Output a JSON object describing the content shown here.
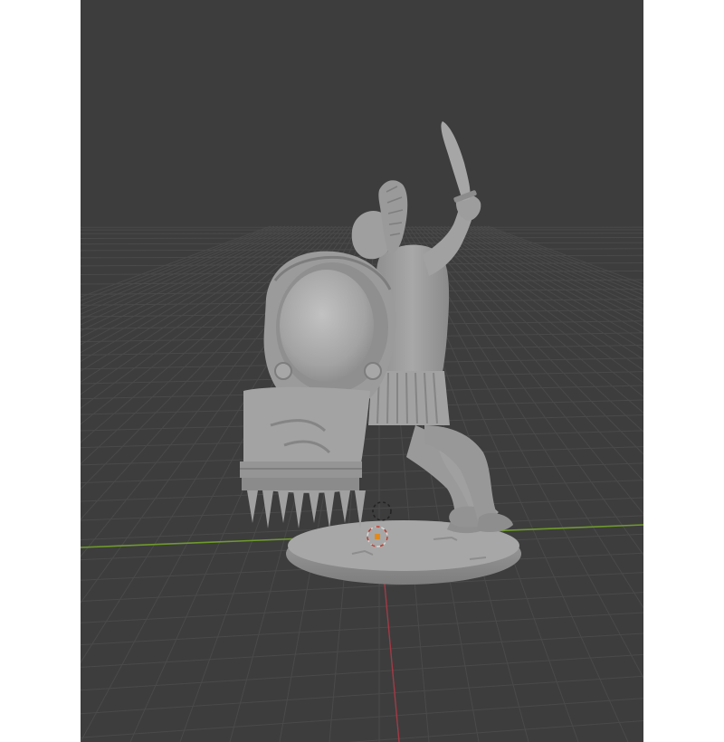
{
  "app": {
    "name": "3D viewport",
    "view": "perspective"
  },
  "viewport": {
    "background_color": "#3d3d3d",
    "grid_line_color": "#4a4a4a",
    "x_axis_color": "#6f9a2c",
    "y_axis_color": "#a33a45",
    "model_color": "#9c9c9c"
  },
  "scene": {
    "object": "warrior-statue-model",
    "base": "oval-base",
    "gizmos": [
      "3d-cursor-icon",
      "object-origin-icon"
    ]
  }
}
